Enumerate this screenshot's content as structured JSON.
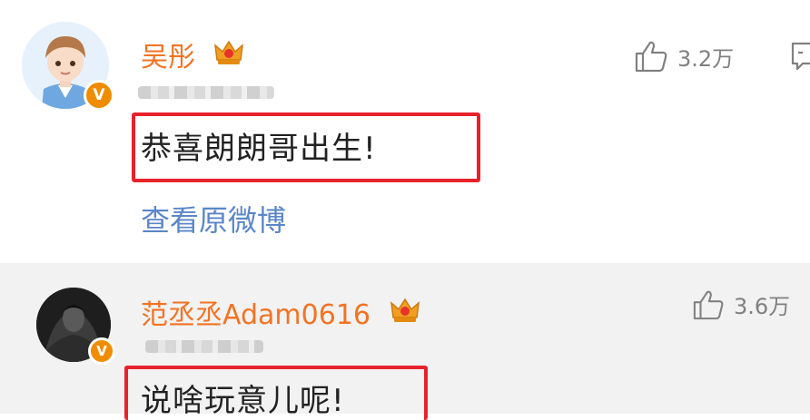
{
  "comments": [
    {
      "username": "吴彤",
      "text": "恭喜朗朗哥出生!",
      "link": "查看原微博",
      "likes": "3.2万",
      "verified_badge": "V"
    },
    {
      "username": "范丞丞Adam0616",
      "text": "说啥玩意儿呢!",
      "likes": "3.6万",
      "verified_badge": "V"
    }
  ],
  "colors": {
    "username": "#f37323",
    "highlight_box": "#e8222b",
    "link": "#5b86c8",
    "secondary_text": "#808080",
    "verified_badge": "#f08c00"
  },
  "icons": [
    "thumbs-up-icon",
    "reply-icon",
    "crown-icon",
    "verified-badge"
  ]
}
